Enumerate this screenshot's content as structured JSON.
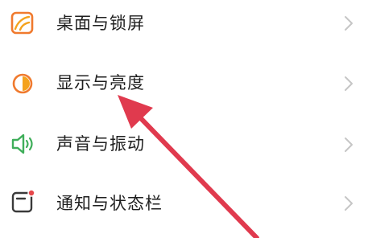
{
  "settings": {
    "items": [
      {
        "label": "桌面与锁屏",
        "icon": "wallpaper-icon",
        "icon_color": "#F07A2E"
      },
      {
        "label": "显示与亮度",
        "icon": "brightness-icon",
        "icon_color": "#F4A21D"
      },
      {
        "label": "声音与振动",
        "icon": "speaker-icon",
        "icon_color": "#3FAE5A"
      },
      {
        "label": "通知与状态栏",
        "icon": "notification-icon",
        "icon_color": "#E6484B"
      }
    ],
    "chevron_icon": "chevron-right-icon",
    "chevron_color": "#C6C6C6",
    "text_color": "#1F1F1F"
  },
  "annotation": {
    "arrow_icon": "red-arrow-icon",
    "arrow_color": "#E03A4E",
    "points_to": "显示与亮度"
  }
}
